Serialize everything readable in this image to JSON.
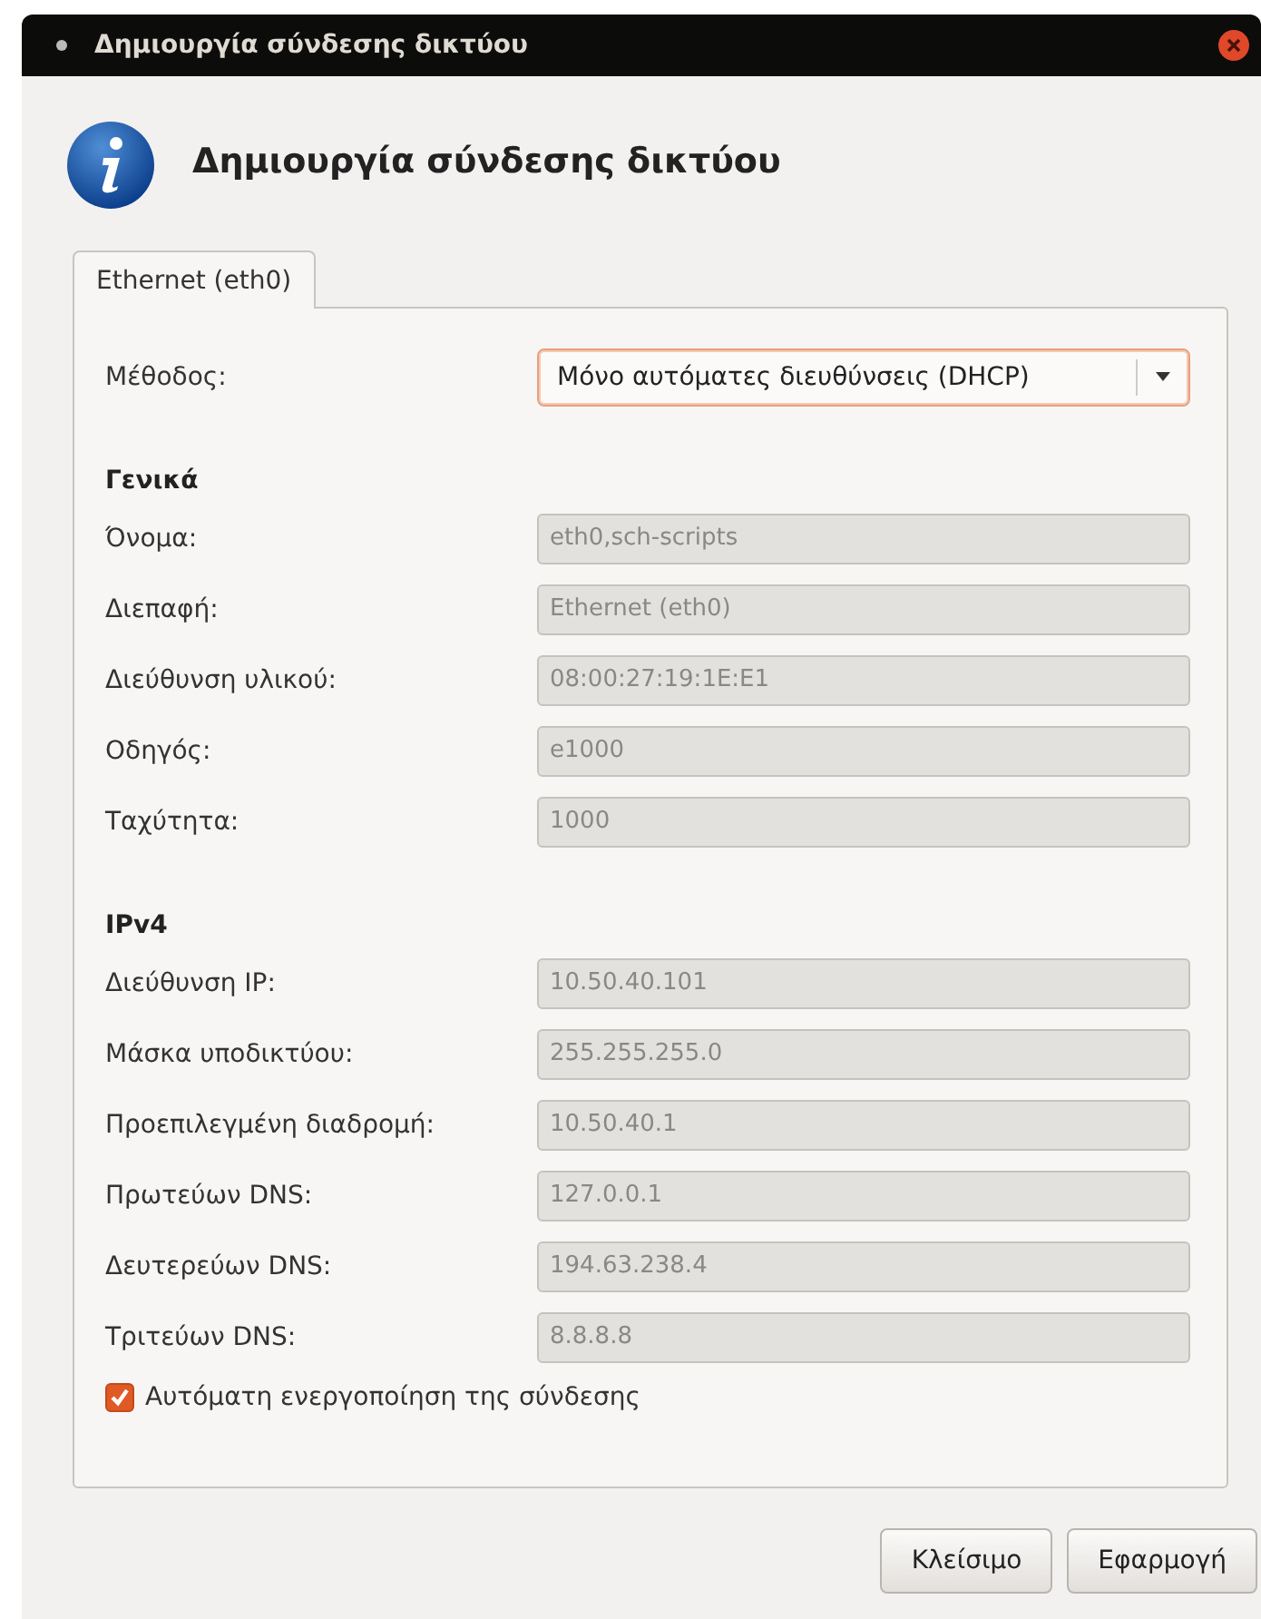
{
  "window": {
    "title": "Δημιουργία σύνδεσης δικτύου"
  },
  "header": {
    "title": "Δημιουργία σύνδεσης δικτύου"
  },
  "tabs": [
    {
      "label": "Ethernet (eth0)",
      "selected": true
    }
  ],
  "method": {
    "label": "Μέθοδος:",
    "value": "Μόνο αυτόματες διευθύνσεις (DHCP)"
  },
  "sections": [
    {
      "title": "Γενικά",
      "fields": [
        {
          "label": "Όνομα:",
          "value": "eth0,sch-scripts",
          "disabled": true
        },
        {
          "label": "Διεπαφή:",
          "value": "Ethernet (eth0)",
          "disabled": true
        },
        {
          "label": "Διεύθυνση υλικού:",
          "value": "08:00:27:19:1E:E1",
          "disabled": true
        },
        {
          "label": "Οδηγός:",
          "value": "e1000",
          "disabled": true
        },
        {
          "label": "Ταχύτητα:",
          "value": "1000",
          "disabled": true
        }
      ]
    },
    {
      "title": "IPv4",
      "fields": [
        {
          "label": "Διεύθυνση IP:",
          "value": "10.50.40.101",
          "disabled": true
        },
        {
          "label": "Μάσκα υποδικτύου:",
          "value": "255.255.255.0",
          "disabled": true
        },
        {
          "label": "Προεπιλεγμένη διαδρομή:",
          "value": "10.50.40.1",
          "disabled": true
        },
        {
          "label": "Πρωτεύων DNS:",
          "value": "127.0.0.1",
          "disabled": true
        },
        {
          "label": "Δευτερεύων DNS:",
          "value": "194.63.238.4",
          "disabled": true
        },
        {
          "label": "Τριτεύων DNS:",
          "value": "8.8.8.8",
          "disabled": true
        }
      ]
    }
  ],
  "autoconnect": {
    "label": "Αυτόματη ενεργοποίηση της σύνδεσης",
    "checked": true
  },
  "buttons": [
    "Κλείσιμο",
    "Εφαρμογή"
  ]
}
